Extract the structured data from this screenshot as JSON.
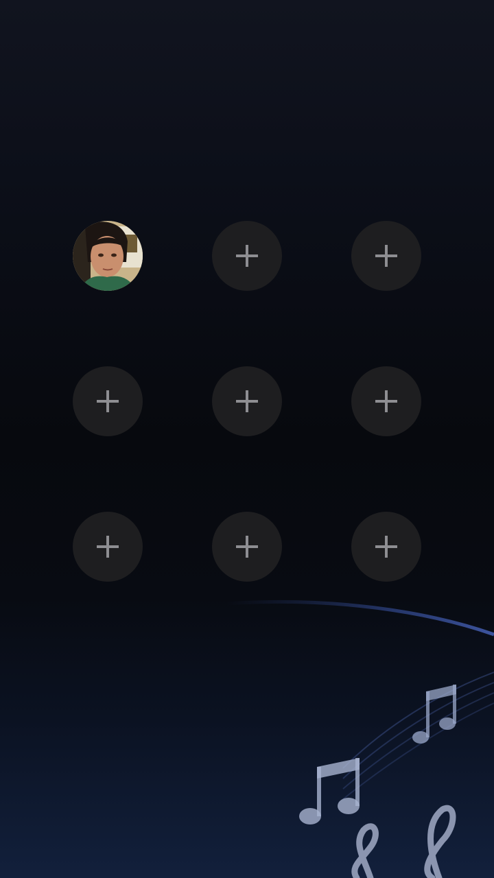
{
  "slots": [
    {
      "type": "photo",
      "icon": "contact-photo"
    },
    {
      "type": "empty",
      "icon": "plus-icon"
    },
    {
      "type": "empty",
      "icon": "plus-icon"
    },
    {
      "type": "empty",
      "icon": "plus-icon"
    },
    {
      "type": "empty",
      "icon": "plus-icon"
    },
    {
      "type": "empty",
      "icon": "plus-icon"
    },
    {
      "type": "empty",
      "icon": "plus-icon"
    },
    {
      "type": "empty",
      "icon": "plus-icon"
    },
    {
      "type": "empty",
      "icon": "plus-icon"
    }
  ],
  "colors": {
    "slot_background": "#1e1e20",
    "plus_color": "#8e8e92",
    "background_top": "#11141f",
    "background_bottom": "#12203c"
  }
}
